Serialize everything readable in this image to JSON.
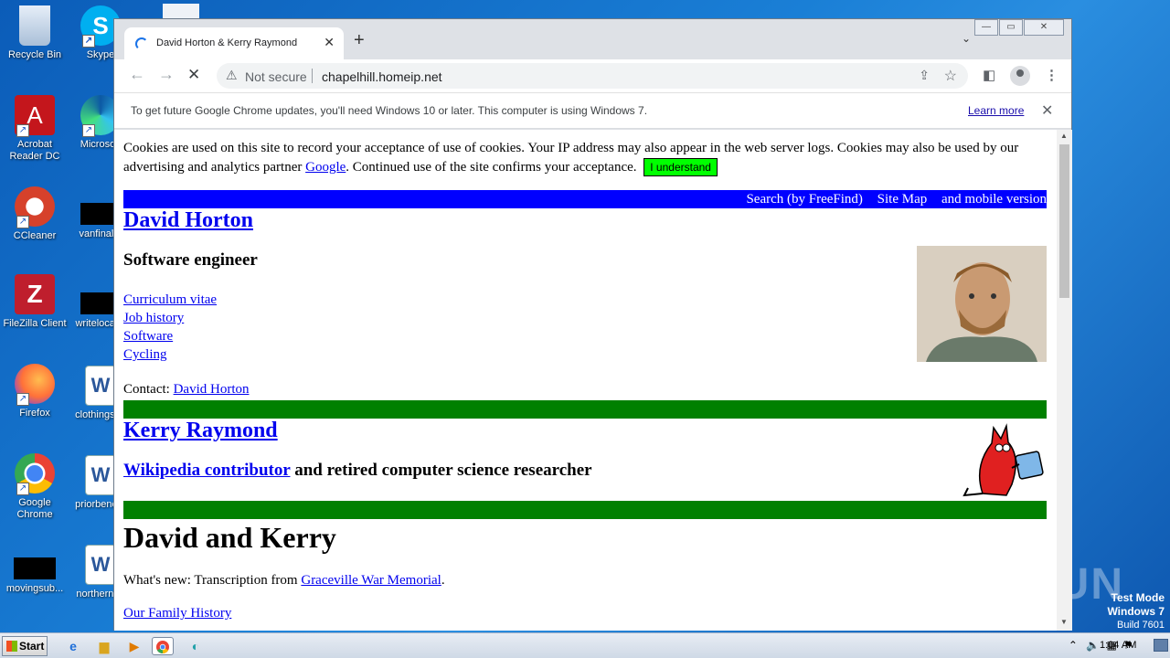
{
  "desktop": {
    "icons": [
      {
        "label": "Recycle Bin",
        "color": "#c8d8ea"
      },
      {
        "label": "Acrobat Reader DC",
        "color": "#c4161c"
      },
      {
        "label": "CCleaner",
        "color": "#d6412b"
      },
      {
        "label": "FileZilla Client",
        "color": "#bf1e2d"
      },
      {
        "label": "Firefox",
        "color": "#ff7139"
      },
      {
        "label": "Google Chrome",
        "color": "#4285f4"
      },
      {
        "label": "movingsub...",
        "color": "#000000"
      },
      {
        "label": "Skype",
        "color": "#00aff0"
      },
      {
        "label": "Microsoft",
        "color": "#0c59a4"
      },
      {
        "label": "vanfinal...",
        "color": "#000000"
      },
      {
        "label": "writelocal...",
        "color": "#000000"
      },
      {
        "label": "clothingst...",
        "color": "#2b579a"
      },
      {
        "label": "priorbene...",
        "color": "#2b579a"
      },
      {
        "label": "northernt...",
        "color": "#2b579a"
      }
    ],
    "watermark": "ANY RUN",
    "test_mode": {
      "line1": "Test Mode",
      "line2": "Windows 7",
      "line3": "Build 7601"
    }
  },
  "browser": {
    "tab_title": "David Horton & Kerry Raymond",
    "tab_close": "✕",
    "new_tab": "+",
    "tab_list": "⌄",
    "window_controls": {
      "minimize": "—",
      "restore": "▭",
      "close": "✕"
    },
    "back": "←",
    "forward": "→",
    "reload": "✕",
    "security_icon": "warning-icon",
    "security_label": "Not secure",
    "url": "chapelhill.homeip.net",
    "infobar": {
      "message": "To get future Google Chrome updates, you'll need Windows 10 or later. This computer is using Windows 7.",
      "link": "Learn more",
      "close": "✕"
    }
  },
  "page": {
    "cookie": {
      "text_before": "Cookies are used on this site to record your acceptance of use of cookies. Your IP address may also appear in the web server logs. Cookies may also be used by our advertising and analytics partner ",
      "link": "Google",
      "text_after": ". Continued use of the site confirms your acceptance. ",
      "button": "I understand"
    },
    "topnav": {
      "search": "Search (by FreeFind)",
      "sitemap": "Site Map",
      "mobile": "and mobile version"
    },
    "david": {
      "heading": "David Horton",
      "subtitle": "Software engineer",
      "links": [
        "Curriculum vitae",
        "Job history",
        "Software",
        "Cycling"
      ],
      "contact_label": "Contact: ",
      "contact_link": "David Horton"
    },
    "kerry": {
      "heading": "Kerry Raymond",
      "wiki_link": "Wikipedia contributor",
      "wiki_rest": " and retired computer science researcher"
    },
    "both": {
      "heading": "David and Kerry",
      "news_label": "What's new: Transcription from ",
      "news_link": "Graceville War Memorial",
      "news_end": ".",
      "family_link": "Our Family History"
    }
  },
  "taskbar": {
    "start": "Start",
    "clock": "1:04 AM"
  }
}
